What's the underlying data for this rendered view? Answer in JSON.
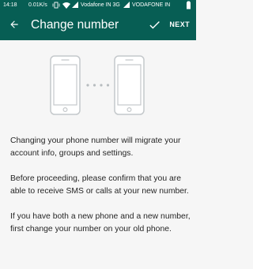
{
  "status_bar": {
    "time": "14:18",
    "speed": "0.01K/s",
    "carrier_1": "Vodafone IN 3G",
    "carrier_2": "VODAFONE IN",
    "background": "#075e54"
  },
  "app_bar": {
    "title": "Change number",
    "back_icon": "arrow-left-icon",
    "next_icon": "check-icon",
    "next_label": "NEXT",
    "background": "#075e54"
  },
  "illustration": {
    "left_device": "phone-icon",
    "right_device": "phone-icon",
    "connector": "dots"
  },
  "paragraphs": [
    "Changing your phone number will migrate your account info, groups and settings.",
    "Before proceeding, please confirm that you are able to receive SMS or calls at your new number.",
    "If you have both a new phone and a new number, first change your number on your old phone."
  ]
}
